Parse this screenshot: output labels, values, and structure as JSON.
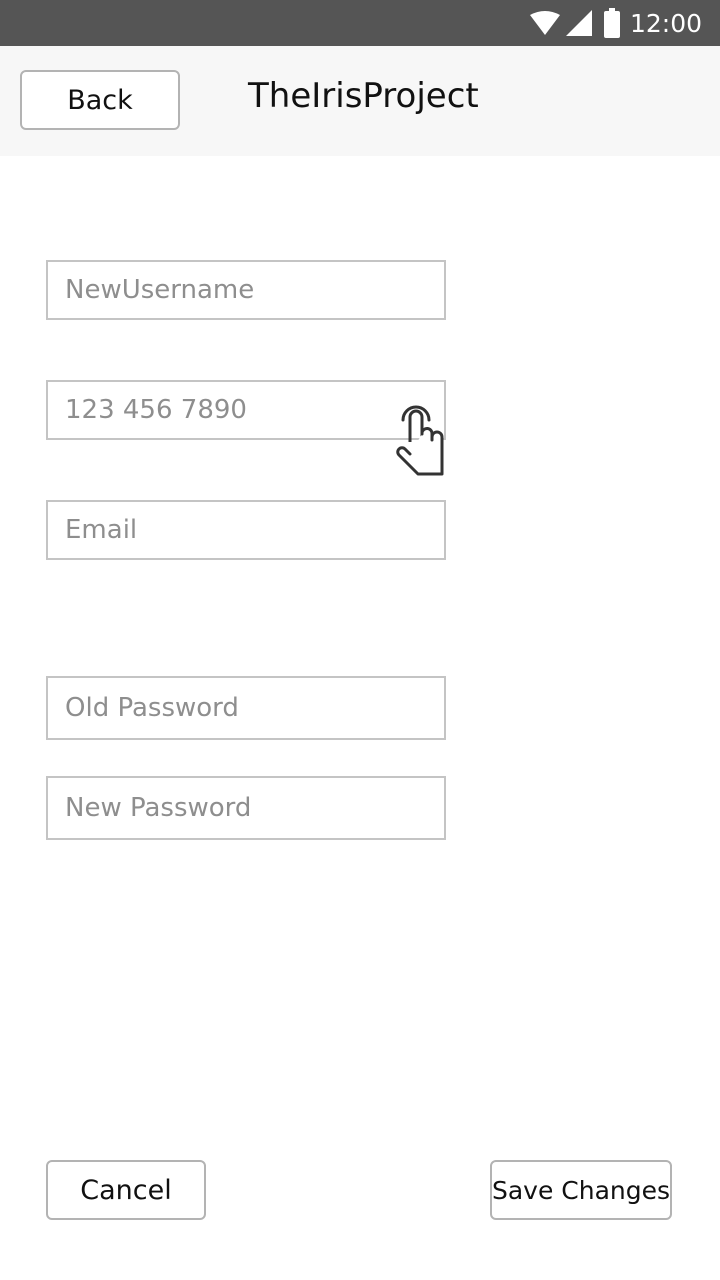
{
  "status_bar": {
    "time": "12:00",
    "icons": [
      "wifi-icon",
      "signal-icon",
      "battery-icon"
    ]
  },
  "header": {
    "back_label": "Back",
    "title": "TheIrisProject"
  },
  "form": {
    "username_placeholder": "NewUsername",
    "phone_placeholder": "123 456 7890",
    "email_placeholder": "Email",
    "old_password_placeholder": "Old Password",
    "new_password_placeholder": "New Password"
  },
  "footer": {
    "cancel_label": "Cancel",
    "save_label": "Save Changes"
  },
  "colors": {
    "status_bar": "#555555",
    "app_bar": "#f7f7f7",
    "border": "#c4c4c4",
    "placeholder": "#8e8e8e"
  }
}
